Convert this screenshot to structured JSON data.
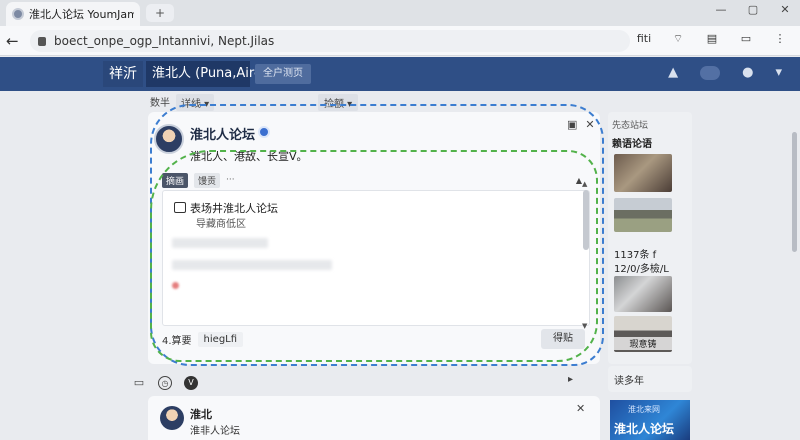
{
  "browser": {
    "tab_title": "淮北人论坛 YoumJames",
    "new_tab_icon": "+",
    "window_buttons": [
      "—",
      "▢",
      "✕"
    ],
    "url": "boect_onpe_ogp_Intannivi, Nept.Jilas",
    "toolbar_icons": [
      "fiti",
      "wifi",
      "book",
      "screen",
      "more"
    ]
  },
  "site_nav": {
    "logo": "祥沂",
    "title": "淮北人 (Puna,Aire)",
    "tag": "全户测页",
    "icons": [
      "bell-icon",
      "toggle-icon",
      "user-icon",
      "chevron-down-icon"
    ]
  },
  "subbar": {
    "items": [
      "数半",
      "详线"
    ],
    "filter": "捡额"
  },
  "post_card": {
    "title": "淮北人论坛",
    "subtitle": "淮北人、港敌、长宣V。",
    "header_icons": [
      "▣",
      "✕"
    ],
    "tabs": {
      "active": "摘画",
      "other": "馒贡",
      "more": "···"
    },
    "post_title": "表场井淮北人论坛",
    "post_sub": "导藏商低区",
    "footer_left": "4.算要",
    "footer_input": "hiegLfi",
    "post_button": "得贴"
  },
  "second_card": {
    "title": "淮北",
    "subtitle": "淮非人论坛"
  },
  "sidebar": {
    "heading_small": "先态站坛",
    "heading": "赖语论语",
    "thumb1_caption": "",
    "date1": "1137条 f",
    "date2": "12/0/多檢/L",
    "thumb4_caption": "瑕意铸",
    "section": "读多年",
    "banner_small": "淮北来网",
    "banner_title": "淮北人论坛"
  },
  "colors": {
    "nav_bg": "#2f4f86",
    "dash_blue": "#3c7dd0",
    "dash_green": "#52b24a"
  }
}
